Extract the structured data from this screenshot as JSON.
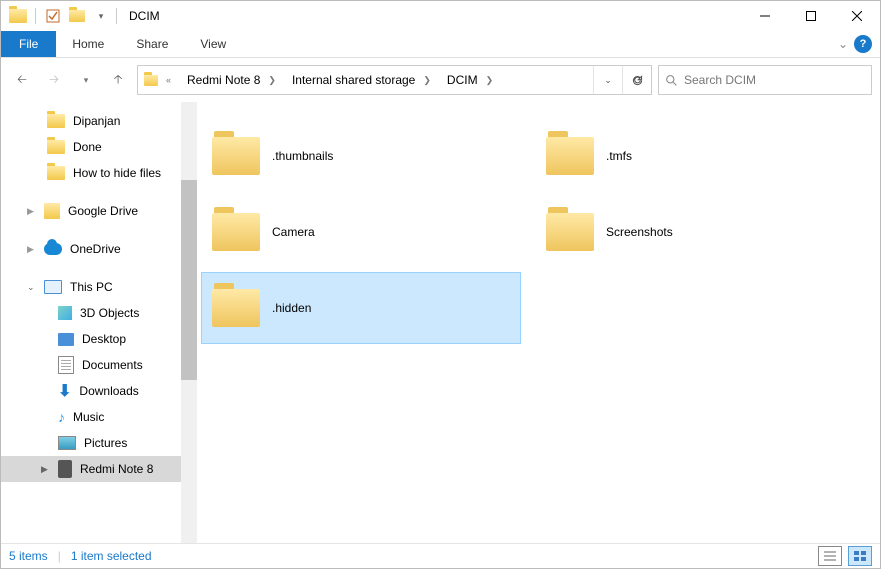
{
  "titlebar": {
    "title": "DCIM"
  },
  "ribbon": {
    "file": "File",
    "home": "Home",
    "share": "Share",
    "view": "View"
  },
  "breadcrumb": {
    "seg0": "«",
    "seg1": "Redmi Note 8",
    "seg2": "Internal shared storage",
    "seg3": "DCIM"
  },
  "search": {
    "placeholder": "Search DCIM"
  },
  "nav": {
    "dipanjan": "Dipanjan",
    "done": "Done",
    "howto": "How to hide files",
    "gdrive": "Google Drive",
    "onedrive": "OneDrive",
    "thispc": "This PC",
    "objects": "3D Objects",
    "desktop": "Desktop",
    "documents": "Documents",
    "downloads": "Downloads",
    "music": "Music",
    "pictures": "Pictures",
    "phone": "Redmi Note 8"
  },
  "items": {
    "thumbnails": ".thumbnails",
    "tmfs": ".tmfs",
    "camera": "Camera",
    "screenshots": "Screenshots",
    "hidden": ".hidden"
  },
  "status": {
    "count": "5 items",
    "sel": "1 item selected"
  }
}
